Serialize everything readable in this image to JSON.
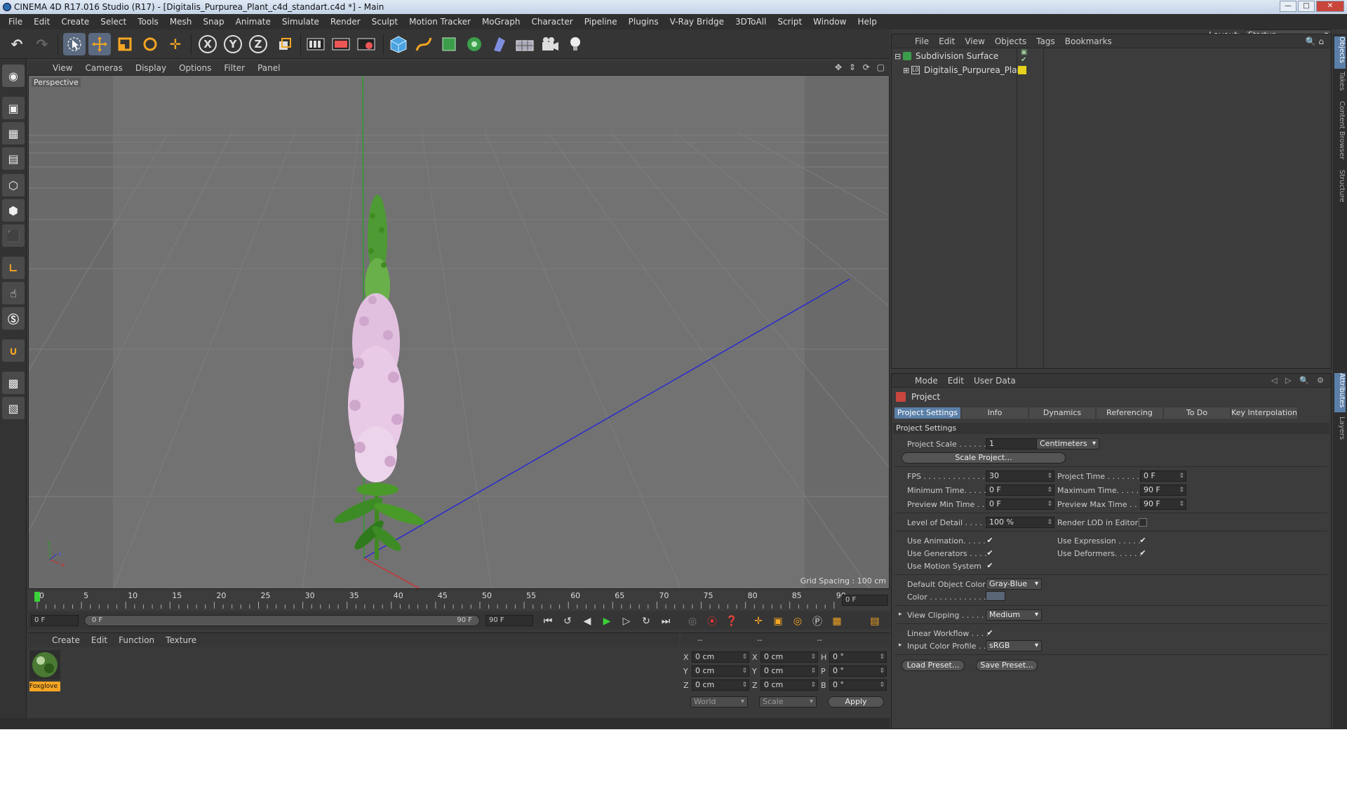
{
  "window": {
    "title": "CINEMA 4D R17.016 Studio (R17) - [Digitalis_Purpurea_Plant_c4d_standart.c4d *] - Main",
    "minimize": "—",
    "maximize": "□",
    "close": "✕"
  },
  "menu": [
    "File",
    "Edit",
    "Create",
    "Select",
    "Tools",
    "Mesh",
    "Snap",
    "Animate",
    "Simulate",
    "Render",
    "Sculpt",
    "Motion Tracker",
    "MoGraph",
    "Character",
    "Pipeline",
    "Plugins",
    "V-Ray Bridge",
    "3DToAll",
    "Script",
    "Window",
    "Help"
  ],
  "layout": {
    "label": "Layout:",
    "value": "Startup"
  },
  "toolbar_glyphs": {
    "undo": "↶",
    "redo": "↷",
    "x": "X",
    "y": "Y",
    "z": "Z"
  },
  "viewport": {
    "menu": [
      "View",
      "Cameras",
      "Display",
      "Options",
      "Filter",
      "Panel"
    ],
    "nav_icons": "✥ ⇕ ⟳ ▢",
    "label": "Perspective",
    "grid_spacing": "Grid Spacing : 100 cm",
    "axis_labels": {
      "x": "x",
      "y": "y",
      "z": "z"
    }
  },
  "timeline": {
    "ticks": [
      "0",
      "5",
      "10",
      "15",
      "20",
      "25",
      "30",
      "35",
      "40",
      "45",
      "50",
      "55",
      "60",
      "65",
      "70",
      "75",
      "80",
      "85",
      "90"
    ],
    "current_frame": "0 F",
    "start": "0 F",
    "range_start": "0 F",
    "range_end": "90 F",
    "end": "90 F"
  },
  "material_panel": {
    "menu": [
      "Create",
      "Edit",
      "Function",
      "Texture"
    ],
    "material_name": "Foxglove"
  },
  "coords": {
    "header": [
      "--",
      "--",
      "--"
    ],
    "rows": [
      {
        "a": "X",
        "av": "0 cm",
        "b": "X",
        "bv": "0 cm",
        "c": "H",
        "cv": "0 °"
      },
      {
        "a": "Y",
        "av": "0 cm",
        "b": "Y",
        "bv": "0 cm",
        "c": "P",
        "cv": "0 °"
      },
      {
        "a": "Z",
        "av": "0 cm",
        "b": "Z",
        "bv": "0 cm",
        "c": "B",
        "cv": "0 °"
      }
    ],
    "space": "World",
    "mode": "Scale",
    "apply": "Apply"
  },
  "object_manager": {
    "menu": [
      "File",
      "Edit",
      "View",
      "Objects",
      "Tags",
      "Bookmarks"
    ],
    "objects": [
      {
        "name": "Subdivision Surface",
        "expander": "⊟"
      },
      {
        "name": "Digitalis_Purpurea_Plant",
        "expander": "⊞"
      }
    ]
  },
  "attributes": {
    "menu": [
      "Mode",
      "Edit",
      "User Data"
    ],
    "title": "Project",
    "tabs": [
      "Project Settings",
      "Info",
      "Dynamics",
      "Referencing",
      "To Do",
      "Key Interpolation"
    ],
    "section": "Project Settings",
    "project_scale_label": "Project Scale . . . . . .",
    "project_scale": "1",
    "units": "Centimeters",
    "scale_project": "Scale Project...",
    "fps_label": "FPS . . . . . . . . . . . . . .",
    "fps": "30",
    "project_time_label": "Project Time . . . . . . . .",
    "project_time": "0 F",
    "min_time_label": "Minimum Time. . . . . . .",
    "min_time": "0 F",
    "max_time_label": "Maximum Time. . . . . . .",
    "max_time": "90 F",
    "prev_min_label": "Preview Min Time . . .",
    "prev_min": "0 F",
    "prev_max_label": "Preview Max Time . . .",
    "prev_max": "90 F",
    "lod_label": "Level of Detail . . . . .",
    "lod": "100 %",
    "render_lod_label": "Render LOD in Editor",
    "use_anim_label": "Use Animation. . . . .",
    "use_expr_label": "Use Expression . . . . .",
    "use_gen_label": "Use Generators . . . .",
    "use_def_label": "Use Deformers. . . . . .",
    "use_motion_label": "Use Motion System",
    "check": "✔",
    "default_color_label": "Default Object Color",
    "default_color": "Gray-Blue",
    "color_label": "Color . . . . . . . . . . . .",
    "view_clip_label": "View Clipping . . . . .",
    "view_clip": "Medium",
    "linear_label": "Linear Workflow . . . .",
    "input_profile_label": "Input Color Profile . .",
    "input_profile": "sRGB",
    "load_preset": "Load Preset...",
    "save_preset": "Save Preset..."
  },
  "side_tabs": [
    "Objects",
    "Takes",
    "Content Browser",
    "Structure",
    "Attributes",
    "Layers"
  ],
  "colors": {
    "accent": "#5b7fa8",
    "viewport": "#6b6b6b",
    "flower": "#e8c9e6",
    "stem": "#4a9a2a"
  }
}
